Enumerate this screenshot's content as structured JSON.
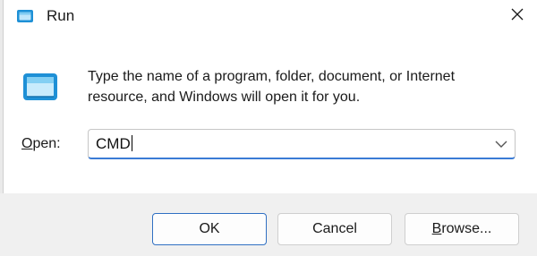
{
  "window": {
    "title": "Run",
    "close_glyph": "✕"
  },
  "icons": {
    "title_icon": "run-icon",
    "main_icon": "run-icon",
    "close": "close-icon",
    "dropdown": "chevron-down-icon"
  },
  "main": {
    "description": "Type the name of a program, folder, document, or Internet resource, and Windows will open it for you.",
    "open_label_prefix": "O",
    "open_label_rest": "pen:",
    "open_value": "CMD"
  },
  "buttons": {
    "ok": "OK",
    "cancel": "Cancel",
    "browse_prefix": "B",
    "browse_rest": "rowse..."
  },
  "colors": {
    "accent": "#3a7bd5",
    "footer_bg": "#f0f0f0",
    "icon_blue": "#1e90d6"
  }
}
